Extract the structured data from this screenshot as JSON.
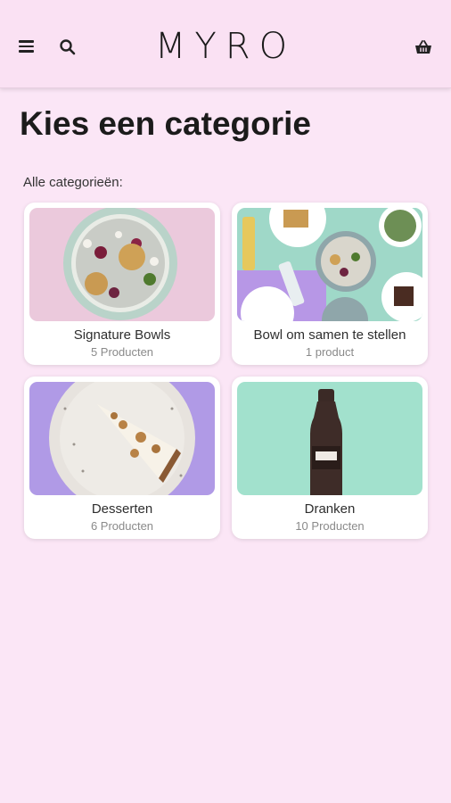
{
  "header": {
    "brand": "MYRO",
    "menu_icon": "hamburger-menu-icon",
    "search_icon": "search-icon",
    "cart_icon": "basket-icon"
  },
  "main": {
    "title": "Kies een categorie",
    "section_label": "Alle categorieën:",
    "categories": [
      {
        "name": "Signature Bowls",
        "count": "5 Producten",
        "image": "salad-bowl-photo"
      },
      {
        "name": "Bowl om samen te stellen",
        "count": "1 product",
        "image": "multiple-bowls-photo"
      },
      {
        "name": "Desserten",
        "count": "6 Producten",
        "image": "cake-slice-photo"
      },
      {
        "name": "Dranken",
        "count": "10 Producten",
        "image": "water-bottle-photo"
      }
    ]
  },
  "colors": {
    "background": "#fbe6f6",
    "header": "#fae1f3",
    "card": "#ffffff",
    "muted_text": "#8a8a8a"
  }
}
